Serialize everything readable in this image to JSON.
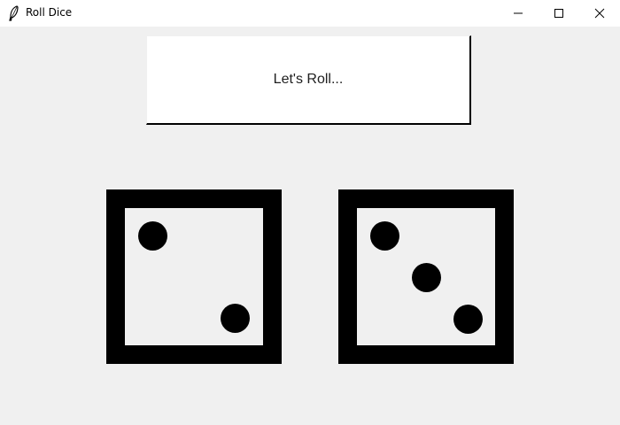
{
  "window": {
    "title": "Roll Dice",
    "icon": "feather-icon",
    "controls": [
      "minimize-icon",
      "maximize-icon",
      "close-icon"
    ]
  },
  "roll_button": {
    "label": "Let's Roll..."
  },
  "dice": [
    {
      "value": 2
    },
    {
      "value": 3
    }
  ],
  "colors": {
    "background": "#f0f0f0",
    "button_bg": "#ffffff",
    "die": "#000000"
  }
}
